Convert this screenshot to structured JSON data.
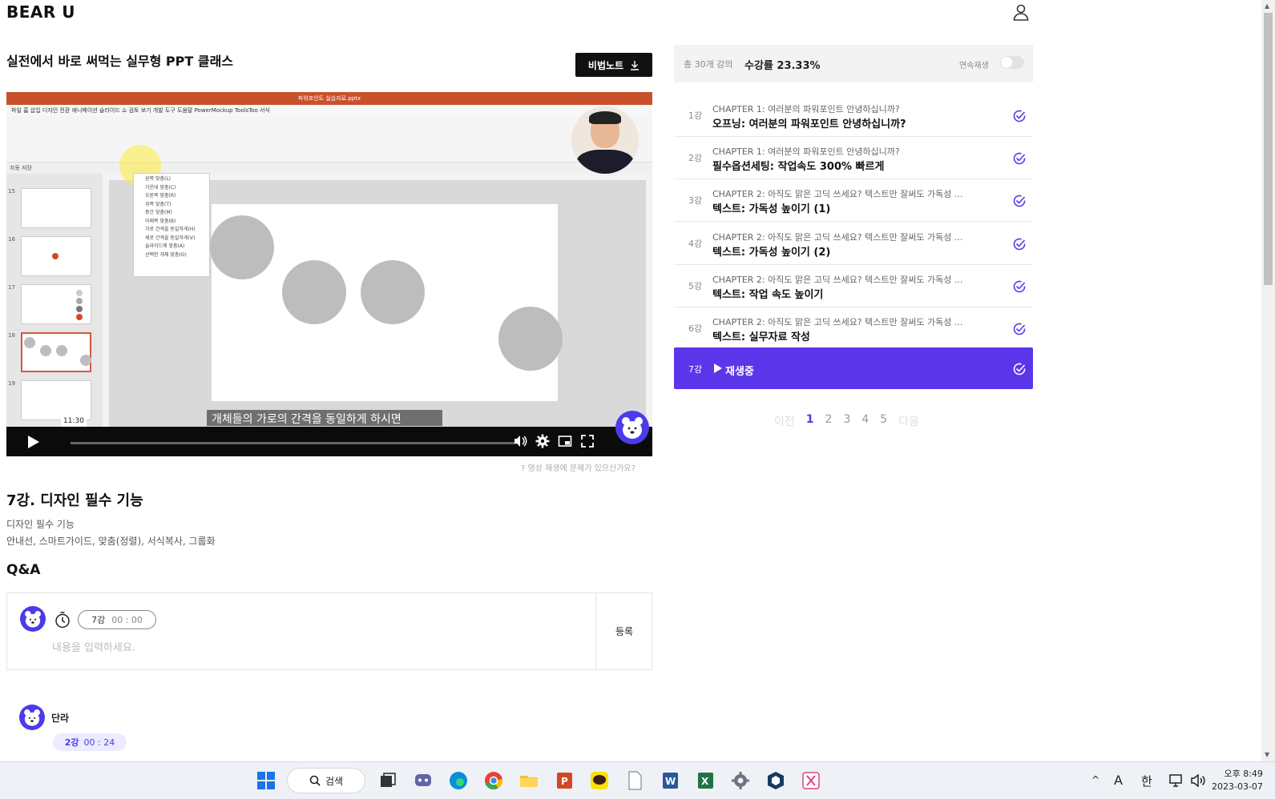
{
  "header": {
    "logo": "BEAR U"
  },
  "course": {
    "title": "실전에서 바로 써먹는 실무형 PPT 클래스",
    "note_button": "비법노트"
  },
  "video": {
    "ppt_window_title": "파워포인트 실습자료.pptx",
    "ppt_menu": "파일    홈    삽입    디자인    전환    애니메이션    슬라이드 쇼    검토    보기    개발 도구    도움말    PowerMockup    ToolsToo    서식",
    "ppt_qat": "자동 저장",
    "thumb_numbers": [
      "15",
      "16",
      "17",
      "18",
      "19"
    ],
    "context_menu": [
      "왼쪽 맞춤(L)",
      "가운데 맞춤(C)",
      "오른쪽 맞춤(R)",
      "위쪽 맞춤(T)",
      "중간 맞춤(M)",
      "아래쪽 맞춤(B)",
      "가로 간격을 동일하게(H)",
      "세로 간격을 동일하게(V)",
      "슬라이드에 맞춤(A)",
      "선택한 개체 맞춤(O)"
    ],
    "subtitle": "개체들의 가로의 간격을 동일하게 하시면",
    "time_tooltip": "11:30",
    "progress": 0.0
  },
  "video_help": "영상 재생에 문제가 있으신가요?",
  "lesson": {
    "title": "7강. 디자인 필수 기능",
    "subtitle": "디자인 필수 기능",
    "description": "안내선, 스마트가이드, 맞춤(정렬), 서식복사, 그룹화"
  },
  "qa": {
    "title": "Q&A",
    "lecture": "7강",
    "time": "00 : 00",
    "placeholder": "내용을 입력하세요.",
    "submit": "등록"
  },
  "comment": {
    "author": "단라",
    "lecture": "2강",
    "time": "00 : 24"
  },
  "progress_panel": {
    "total": "총 30개 강의",
    "rate": "수강률 23.33%",
    "autoplay": "연속재생",
    "autoplay_on": false
  },
  "lectures": [
    {
      "num": "1강",
      "chapter": "CHAPTER 1: 여러분의 파워포인트 안녕하십니까?",
      "name": "오프닝: 여러분의 파워포인트 안녕하십니까?"
    },
    {
      "num": "2강",
      "chapter": "CHAPTER 1: 여러분의 파워포인트 안녕하십니까?",
      "name": "필수옵션세팅: 작업속도 300% 빠르게"
    },
    {
      "num": "3강",
      "chapter": "CHAPTER 2: 아직도 맑은 고딕 쓰세요? 텍스트만 잘써도 가독성 ...",
      "name": "텍스트: 가독성 높이기 (1)"
    },
    {
      "num": "4강",
      "chapter": "CHAPTER 2: 아직도 맑은 고딕 쓰세요? 텍스트만 잘써도 가독성 ...",
      "name": "텍스트: 가독성 높이기 (2)"
    },
    {
      "num": "5강",
      "chapter": "CHAPTER 2: 아직도 맑은 고딕 쓰세요? 텍스트만 잘써도 가독성 ...",
      "name": "텍스트: 작업 속도 높이기"
    },
    {
      "num": "6강",
      "chapter": "CHAPTER 2: 아직도 맑은 고딕 쓰세요? 텍스트만 잘써도 가독성 ...",
      "name": "텍스트: 실무자료 작성"
    }
  ],
  "current_lecture": {
    "num": "7강",
    "label": "재생중"
  },
  "pager": {
    "prev": "이전",
    "pages": [
      "1",
      "2",
      "3",
      "4",
      "5"
    ],
    "active": "1",
    "next": "다음"
  },
  "taskbar": {
    "search": "검색",
    "ime_a": "A",
    "ime_han": "한",
    "time": "오후 8:49",
    "date": "2023-03-07"
  },
  "colors": {
    "accent": "#5b35ea",
    "brand_bear": "#4c3bea"
  }
}
